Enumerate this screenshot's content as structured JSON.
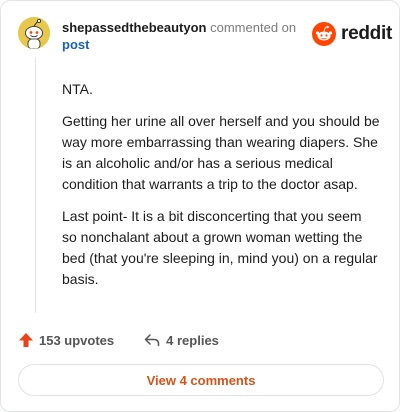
{
  "header": {
    "username": "shepassedthebeautyon",
    "action": "commented on",
    "post_link": "post",
    "logo_text": "reddit"
  },
  "comment": {
    "paragraphs": [
      "NTA.",
      "Getting her urine all over herself and you should be way more embarrassing than wearing diapers. She is an alcoholic and/or has a serious medical condition that warrants a trip to the doctor asap.",
      "Last point- It is a bit disconcerting that you seem so nonchalant about a grown woman wetting the bed (that you're sleeping in, mind you) on a regular basis."
    ]
  },
  "footer": {
    "upvotes": "153 upvotes",
    "replies": "4 replies"
  },
  "view_button": "View 4 comments",
  "colors": {
    "accent": "#d4541a",
    "brand": "#ff4500",
    "link": "#1b5fbf"
  },
  "icons": [
    "snoo-avatar-icon",
    "reddit-logo-icon",
    "upvote-arrow-icon",
    "reply-arrow-icon"
  ]
}
